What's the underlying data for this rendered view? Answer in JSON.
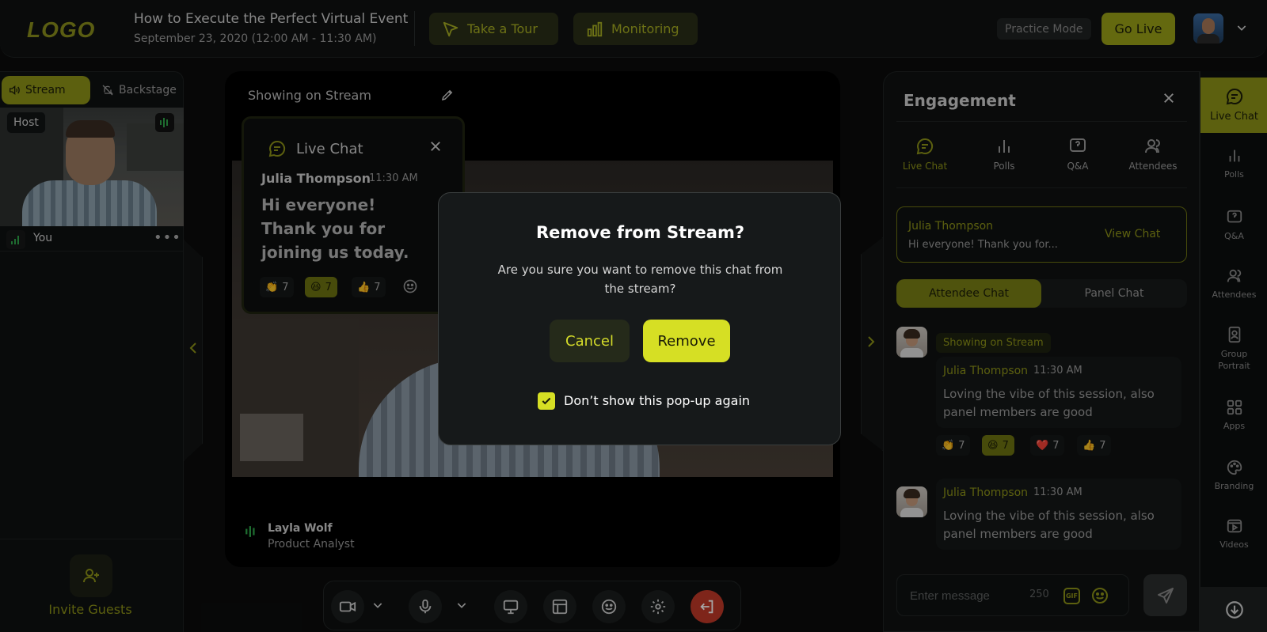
{
  "header": {
    "logo_text": "LOGO",
    "event_title": "How to Execute the Perfect Virtual Event",
    "event_date": "September 23, 2020 (12:00 AM - 11:30 AM)",
    "take_tour_label": "Take a Tour",
    "monitoring_label": "Monitoring",
    "practice_mode_label": "Practice Mode",
    "go_live_label": "Go Live"
  },
  "left_panel": {
    "stream_tab_label": "Stream",
    "backstage_tab_label": "Backstage",
    "host_badge": "Host",
    "you_label": "You",
    "more_label": "•••",
    "invite_label": "Invite Guests"
  },
  "stream": {
    "showing_label": "Showing on Stream",
    "speaker_name": "Layla Wolf",
    "speaker_role": "Product Analyst"
  },
  "live_chat_card": {
    "title": "Live Chat",
    "author": "Julia Thompson",
    "time": "11:30 AM",
    "message": "Hi everyone! Thank you for joining us today.",
    "reactions": [
      {
        "emoji": "👏",
        "count": "7",
        "active": false
      },
      {
        "emoji": "😆",
        "count": "7",
        "active": true
      },
      {
        "emoji": "👍",
        "count": "7",
        "active": false
      }
    ]
  },
  "modal": {
    "title": "Remove from Stream?",
    "text": "Are you sure you want to remove this chat from the stream?",
    "cancel_label": "Cancel",
    "remove_label": "Remove",
    "checkbox_label": "Don’t show this pop-up again",
    "checkbox_checked": true
  },
  "engagement": {
    "title": "Engagement",
    "tabs": [
      {
        "label": "Live Chat",
        "icon": "chat-icon",
        "active": true
      },
      {
        "label": "Polls",
        "icon": "polls-icon",
        "active": false
      },
      {
        "label": "Q&A",
        "icon": "qa-icon",
        "active": false
      },
      {
        "label": "Attendees",
        "icon": "attendees-icon",
        "active": false
      }
    ],
    "pinned": {
      "author": "Julia Thompson",
      "text": "Hi everyone! Thank you for...",
      "view_label": "View Chat"
    },
    "attendee_chat_label": "Attendee Chat",
    "panel_chat_label": "Panel Chat",
    "showing_on_stream_tag": "Showing on Stream",
    "messages": [
      {
        "author": "Julia Thompson",
        "time": "11:30 AM",
        "text": "Loving the vibe of this session, also panel members are good"
      },
      {
        "author": "Julia Thompson",
        "time": "11:30 AM",
        "text": "Loving the vibe of this session, also panel members are good"
      }
    ],
    "message_reactions": [
      {
        "emoji": "👏",
        "count": "7",
        "active": false
      },
      {
        "emoji": "😆",
        "count": "7",
        "active": true
      },
      {
        "emoji": "❤️",
        "count": "7",
        "active": false
      },
      {
        "emoji": "👍",
        "count": "7",
        "active": false
      }
    ],
    "input_placeholder": "Enter message",
    "char_count": "250",
    "gif_label": "GIF"
  },
  "right_nav": [
    {
      "label": "Live Chat",
      "icon": "chat-icon",
      "active": true
    },
    {
      "label": "Polls",
      "icon": "polls-icon",
      "active": false
    },
    {
      "label": "Q&A",
      "icon": "qa-icon",
      "active": false
    },
    {
      "label": "Attendees",
      "icon": "attendees-icon",
      "active": false
    },
    {
      "label": "Group Portrait",
      "icon": "portrait-icon",
      "active": false
    },
    {
      "label": "Apps",
      "icon": "apps-icon",
      "active": false
    },
    {
      "label": "Branding",
      "icon": "palette-icon",
      "active": false
    },
    {
      "label": "Videos",
      "icon": "videos-icon",
      "active": false
    }
  ],
  "colors": {
    "accent": "#d6df24",
    "accent_dim": "#8e9418",
    "danger": "#c23a28",
    "background": "#0b0c0c"
  }
}
